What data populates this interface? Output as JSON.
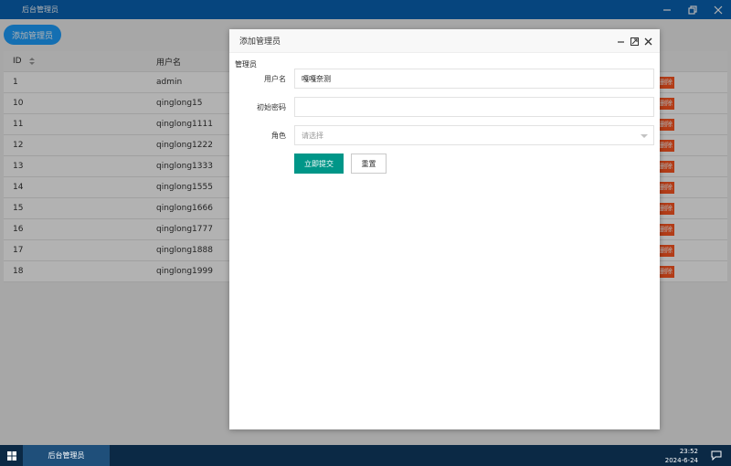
{
  "window": {
    "title": "后台管理员"
  },
  "toolbar": {
    "add_label": "添加管理员"
  },
  "table": {
    "headers": {
      "id": "ID",
      "username": "用户名"
    },
    "delete_label": "删除",
    "rows": [
      {
        "id": "1",
        "username": "admin"
      },
      {
        "id": "10",
        "username": "qinglong15"
      },
      {
        "id": "11",
        "username": "qinglong1111"
      },
      {
        "id": "12",
        "username": "qinglong1222"
      },
      {
        "id": "13",
        "username": "qinglong1333"
      },
      {
        "id": "14",
        "username": "qinglong1555"
      },
      {
        "id": "15",
        "username": "qinglong1666"
      },
      {
        "id": "16",
        "username": "qinglong1777"
      },
      {
        "id": "17",
        "username": "qinglong1888"
      },
      {
        "id": "18",
        "username": "qinglong1999"
      }
    ]
  },
  "modal": {
    "title": "添加管理员",
    "section": "管理员",
    "username_label": "用户名",
    "username_value": "嘎嘎奈测",
    "password_label": "初始密码",
    "password_value": "",
    "role_label": "角色",
    "role_placeholder": "请选择",
    "submit_label": "立即提交",
    "reset_label": "重置"
  },
  "taskbar": {
    "app_label": "后台管理员",
    "time": "23:52",
    "date": "2024-6-24"
  },
  "colors": {
    "titlebar": "#0a63b5",
    "primary": "#1e9fff",
    "submit": "#009688",
    "danger": "#ff5722",
    "taskbar": "#0b2945"
  }
}
